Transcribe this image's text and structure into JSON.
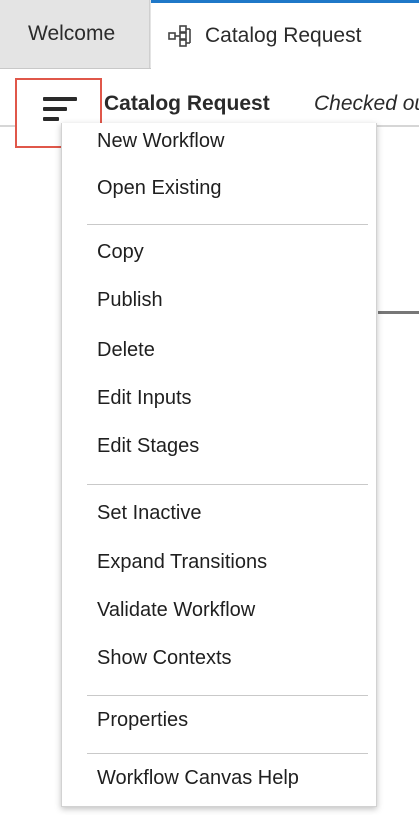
{
  "tabs": {
    "welcome_label": "Welcome",
    "active_label": "Catalog Request",
    "active_icon": "workflow-icon"
  },
  "toolbar": {
    "menu_icon": "hamburger-menu-icon",
    "title": "Catalog Request",
    "status": "Checked out"
  },
  "menu": {
    "items": [
      "New Workflow",
      "Open Existing",
      "Copy",
      "Publish",
      "Delete",
      "Edit Inputs",
      "Edit Stages",
      "Set Inactive",
      "Expand Transitions",
      "Validate Workflow",
      "Show Contexts",
      "Properties",
      "Workflow Canvas Help"
    ]
  },
  "colors": {
    "highlight_border": "#e0574a",
    "active_tab_accent": "#1f78c8",
    "tab_bar_background": "#e4e4e4"
  }
}
